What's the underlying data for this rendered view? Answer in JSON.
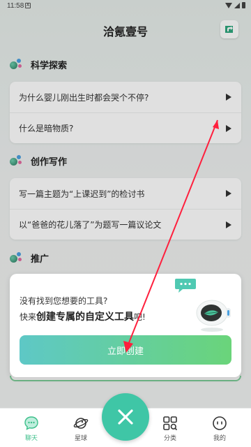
{
  "status_bar": {
    "time": "11:58",
    "notification_glyph": "A"
  },
  "header": {
    "title": "洽氪壹号",
    "share_icon": "share-icon"
  },
  "sections": [
    {
      "label": "科学探索",
      "items": [
        "为什么婴儿刚出生时都会哭个不停?",
        "什么是暗物质?"
      ]
    },
    {
      "label": "创作写作",
      "items": [
        "写一篇主题为“上课迟到”的检讨书",
        "以“爸爸的花儿落了”为题写一篇议论文"
      ]
    },
    {
      "label": "推广",
      "items": []
    }
  ],
  "popup": {
    "line1": "没有找到您想要的工具?",
    "line2_prefix": "快来",
    "line2_emphasis": "创建专属的自定义工具",
    "line2_suffix": "吧!",
    "button_label": "立即创建"
  },
  "bottom_nav": {
    "items": [
      {
        "label": "聊天",
        "icon": "chat-icon",
        "active": true
      },
      {
        "label": "星球",
        "icon": "planet-icon",
        "active": false
      },
      {
        "label": "分类",
        "icon": "category-icon",
        "active": false
      },
      {
        "label": "我的",
        "icon": "profile-icon",
        "active": false
      }
    ],
    "center_icon": "close-icon"
  },
  "colors": {
    "accent": "#3fc6a6",
    "annotation_arrow": "#ff1f3d"
  }
}
